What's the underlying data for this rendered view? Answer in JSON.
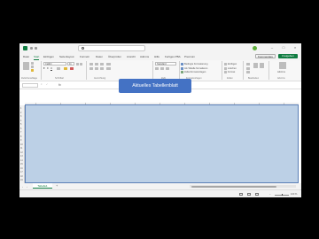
{
  "title_bar": {
    "title": "",
    "search_placeholder": ""
  },
  "ribbon_tabs": [
    "Datei",
    "Start",
    "Einfügen",
    "Seitenlayout",
    "Formeln",
    "Daten",
    "Überprüfen",
    "Ansicht",
    "Add-ins",
    "Hilfe",
    "Fertiges PBA",
    "Premium"
  ],
  "active_tab": "Start",
  "header_buttons": {
    "comments": "Kommentare",
    "share": "Freigeben"
  },
  "ribbon": {
    "font_name": "Calibri",
    "font_size": "11",
    "number_format": "Standard",
    "styles": {
      "conditional": "Bedingte Formatierung",
      "as_table": "Als Tabelle formatieren",
      "cell_styles": "Zellenformatvorlagen"
    },
    "cells": {
      "insert": "Einfügen",
      "delete": "Löschen",
      "format": "Format"
    },
    "addins": "Add-Ins",
    "group_labels": {
      "clipboard": "Zwischenablage",
      "font": "Schriftart",
      "alignment": "Ausrichtung",
      "number": "Zahl",
      "styles": "Formatvorlagen",
      "cells": "Zellen",
      "editing": "Bearbeiten",
      "addins": "Add-Ins"
    }
  },
  "formula_bar": {
    "fx": "fx",
    "value": ""
  },
  "grid": {
    "row_numbers": [
      "1",
      "2",
      "3",
      "4",
      "5",
      "6",
      "7",
      "8",
      "9",
      "10",
      "11",
      "12",
      "13",
      "14",
      "15",
      "16",
      "17",
      "18",
      "19"
    ]
  },
  "callout": {
    "text": "Aktuelles Tabellenblatt"
  },
  "sheet_bar": {
    "sheet_tab": "Tabelle1",
    "add_sheet": "+"
  },
  "status_bar": {
    "zoom_level": "100 %"
  },
  "colors": {
    "accent": "#107c41",
    "callout": "#4472c4",
    "overlay": "#bcd0e6"
  }
}
